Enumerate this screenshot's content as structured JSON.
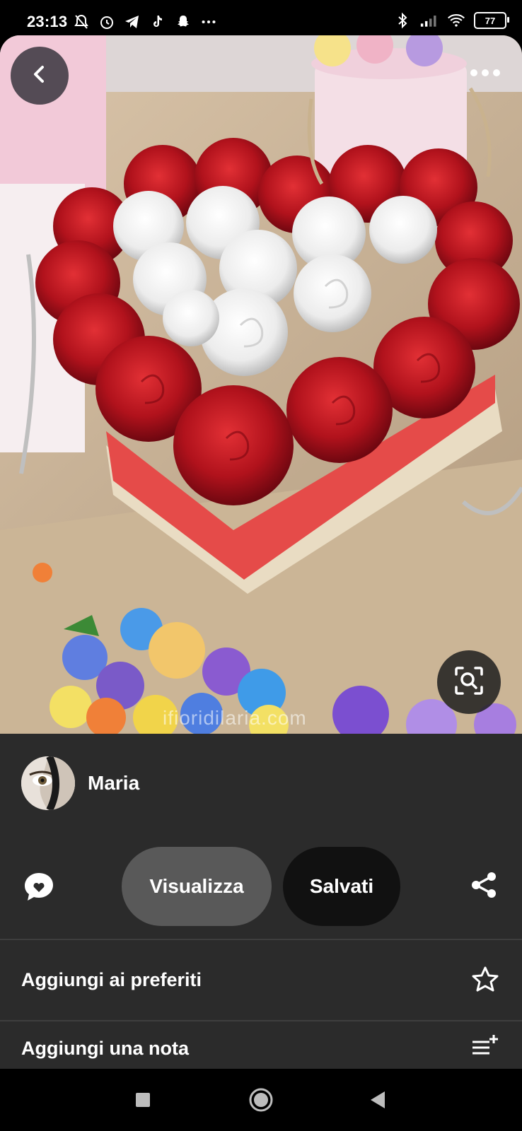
{
  "status_bar": {
    "time": "23:13",
    "left_icons": [
      "bell-off-icon",
      "alarm-icon",
      "telegram-icon",
      "tiktok-icon",
      "snapchat-icon",
      "more-notifications-icon"
    ],
    "right_icons": [
      "bluetooth-icon",
      "signal-icon",
      "wifi-icon"
    ],
    "battery": "77"
  },
  "photo": {
    "watermark": "ifioridilaria.com",
    "back_icon": "chevron-left-icon",
    "more_icon": "more-horizontal-icon",
    "lens_icon": "visual-search-icon"
  },
  "pin": {
    "user_name": "Maria",
    "view_label": "Visualizza",
    "saved_label": "Salvati",
    "comment_icon": "comment-heart-icon",
    "share_icon": "share-icon"
  },
  "menu": [
    {
      "label": "Aggiungi ai preferiti",
      "icon": "star-outline-icon"
    },
    {
      "label": "Aggiungi una nota",
      "icon": "add-note-icon"
    }
  ],
  "nav": [
    "recents-square-icon",
    "home-circle-icon",
    "back-triangle-icon"
  ],
  "colors": {
    "sheet_bg": "#2b2b2b",
    "view_pill": "#595959",
    "saved_pill": "#111111"
  }
}
